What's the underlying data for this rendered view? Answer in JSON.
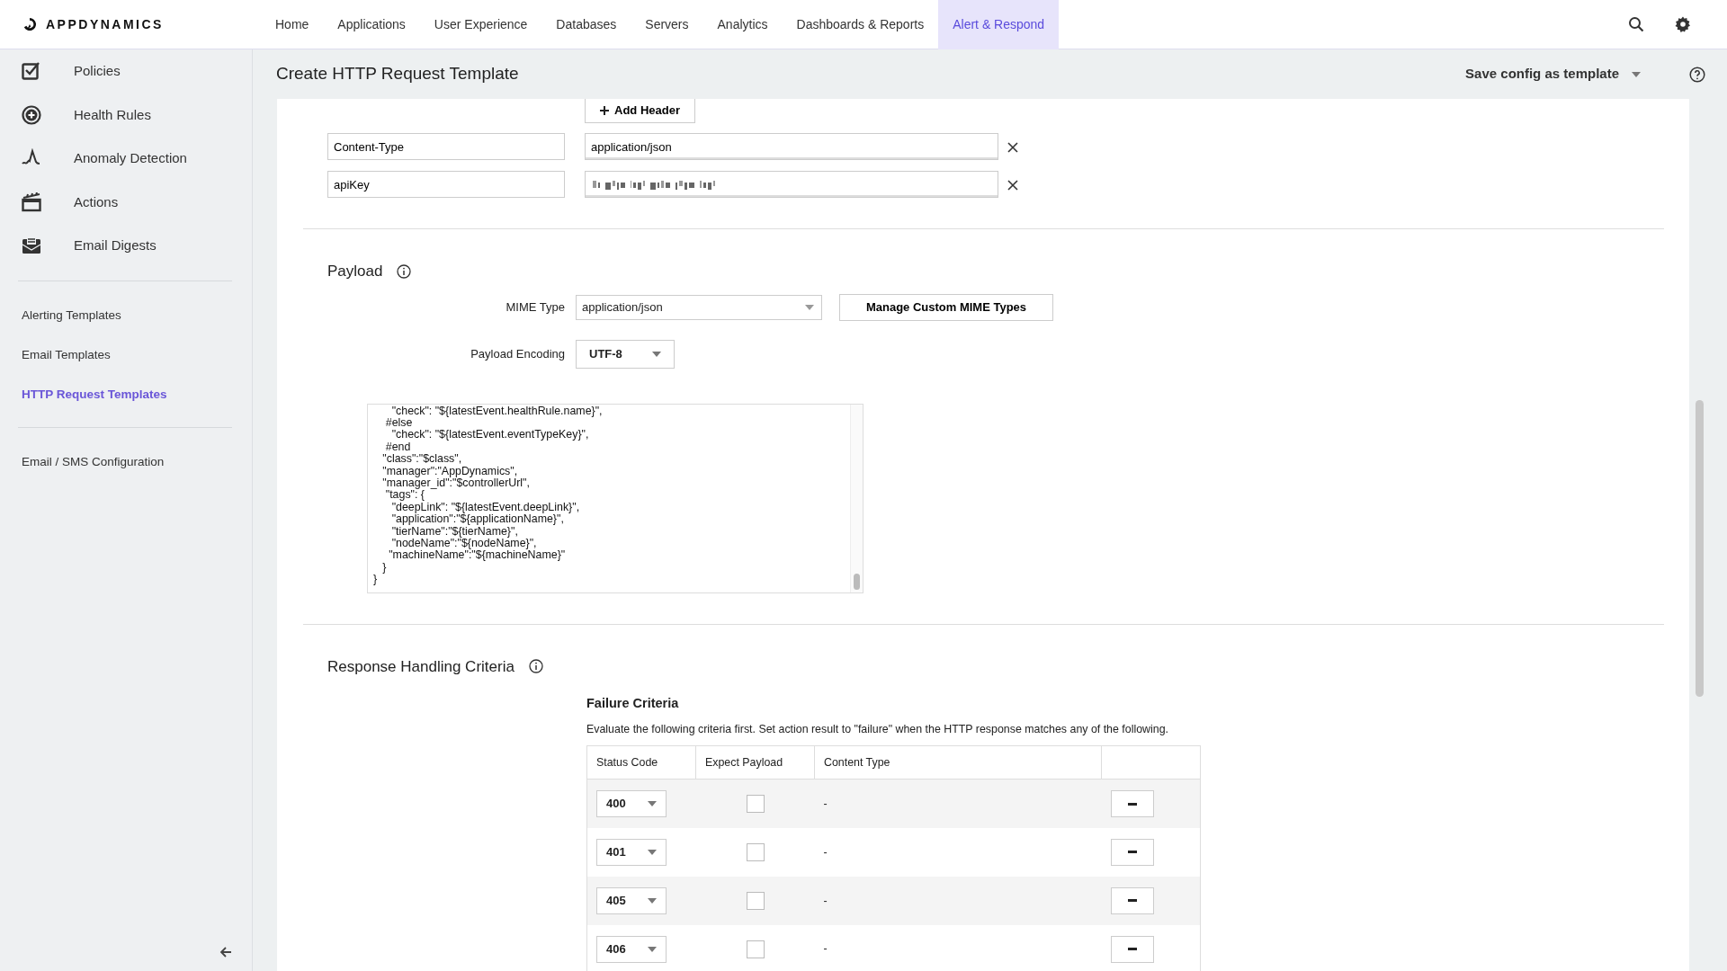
{
  "nav": {
    "brand": "APPDYNAMICS",
    "items": [
      {
        "label": "Home",
        "selected": false
      },
      {
        "label": "Applications",
        "selected": false
      },
      {
        "label": "User Experience",
        "selected": false
      },
      {
        "label": "Databases",
        "selected": false
      },
      {
        "label": "Servers",
        "selected": false
      },
      {
        "label": "Analytics",
        "selected": false
      },
      {
        "label": "Dashboards & Reports",
        "selected": false
      },
      {
        "label": "Alert & Respond",
        "selected": true
      }
    ]
  },
  "sidebar": {
    "items": [
      {
        "label": "Policies"
      },
      {
        "label": "Health Rules"
      },
      {
        "label": "Anomaly Detection"
      },
      {
        "label": "Actions"
      },
      {
        "label": "Email Digests"
      }
    ],
    "templates": [
      {
        "label": "Alerting Templates",
        "selected": false
      },
      {
        "label": "Email Templates",
        "selected": false
      },
      {
        "label": "HTTP Request Templates",
        "selected": true
      }
    ],
    "config": [
      {
        "label": "Email / SMS Configuration",
        "selected": false
      }
    ]
  },
  "page": {
    "title": "Create HTTP Request Template",
    "save_menu": "Save config as template"
  },
  "headers": {
    "add_button": "Add Header",
    "rows": [
      {
        "name": "Content-Type",
        "value": "application/json",
        "redacted": false
      },
      {
        "name": "apiKey",
        "redacted": true
      }
    ]
  },
  "payload": {
    "title": "Payload",
    "mime_label": "MIME Type",
    "mime_value": "application/json",
    "manage_button": "Manage Custom MIME Types",
    "encoding_label": "Payload Encoding",
    "encoding_value": "UTF-8",
    "code_lines": [
      "      \"check\": \"${latestEvent.healthRule.name}\",",
      "    #else",
      "      \"check\": \"${latestEvent.eventTypeKey}\",",
      "    #end",
      "   \"class\":\"$class\",",
      "   \"manager\":\"AppDynamics\",",
      "   \"manager_id\":\"$controllerUrl\",",
      "    \"tags\": {",
      "      \"deepLink\": \"${latestEvent.deepLink}\",",
      "      \"application\":\"${applicationName}\",",
      "      \"tierName\":\"${tierName}\",",
      "      \"nodeName\":\"${nodeName}\",",
      "     \"machineName\":\"${machineName}\"",
      "   }",
      "}"
    ]
  },
  "response": {
    "title": "Response Handling Criteria",
    "failure": {
      "title": "Failure Criteria",
      "description": "Evaluate the following criteria first. Set action result to \"failure\" when the HTTP response matches any of the following.",
      "columns": [
        "Status Code",
        "Expect Payload",
        "Content Type"
      ],
      "rows": [
        {
          "status": "400",
          "expect_payload": false,
          "content_type": "-"
        },
        {
          "status": "401",
          "expect_payload": false,
          "content_type": "-"
        },
        {
          "status": "405",
          "expect_payload": false,
          "content_type": "-"
        },
        {
          "status": "406",
          "expect_payload": false,
          "content_type": "-"
        }
      ]
    }
  }
}
